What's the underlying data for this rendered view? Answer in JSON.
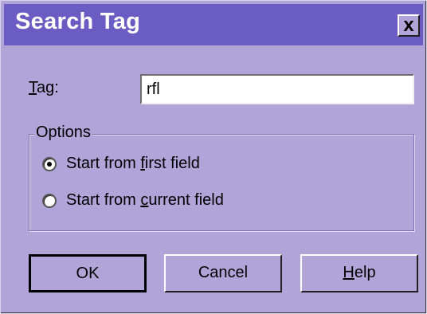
{
  "window": {
    "title": "Search Tag",
    "close_label": "x"
  },
  "tag_field": {
    "label_first": "T",
    "label_rest": "ag:",
    "value": "rfl"
  },
  "options": {
    "group_label": "Options",
    "radios": [
      {
        "prefix": "Start from ",
        "mnemonic": "f",
        "suffix": "irst field",
        "selected": true
      },
      {
        "prefix": "Start from ",
        "mnemonic": "c",
        "suffix": "urrent field",
        "selected": false
      }
    ]
  },
  "buttons": {
    "ok": "OK",
    "cancel": "Cancel",
    "help_first": "H",
    "help_rest": "elp"
  }
}
